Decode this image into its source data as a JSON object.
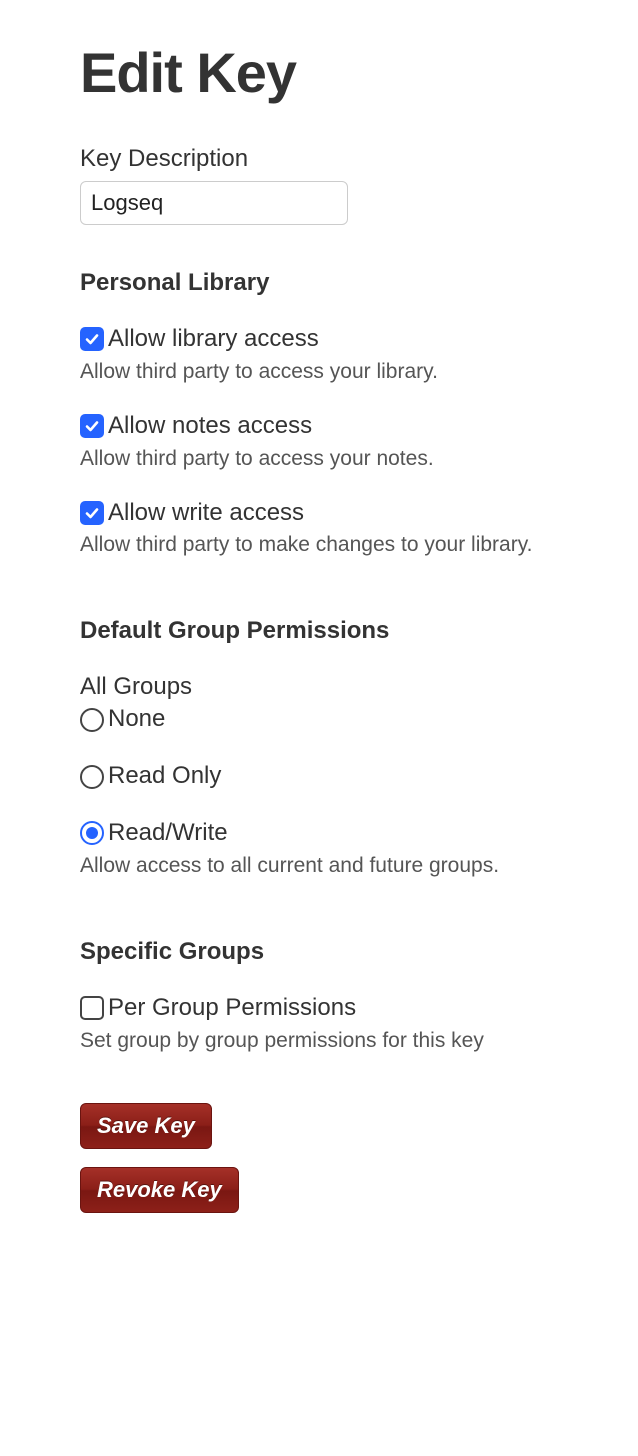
{
  "title": "Edit Key",
  "key_description": {
    "label": "Key Description",
    "value": "Logseq"
  },
  "personal_library": {
    "heading": "Personal Library",
    "options": [
      {
        "label": "Allow library access",
        "desc": "Allow third party to access your library.",
        "checked": true
      },
      {
        "label": "Allow notes access",
        "desc": "Allow third party to access your notes.",
        "checked": true
      },
      {
        "label": "Allow write access",
        "desc": "Allow third party to make changes to your library.",
        "checked": true
      }
    ]
  },
  "group_permissions": {
    "heading": "Default Group Permissions",
    "sub_heading": "All Groups",
    "radios": [
      {
        "label": "None",
        "desc": "",
        "selected": false
      },
      {
        "label": "Read Only",
        "desc": "",
        "selected": false
      },
      {
        "label": "Read/Write",
        "desc": "Allow access to all current and future groups.",
        "selected": true
      }
    ]
  },
  "specific_groups": {
    "heading": "Specific Groups",
    "option": {
      "label": "Per Group Permissions",
      "desc": "Set group by group permissions for this key",
      "checked": false
    }
  },
  "buttons": {
    "save": "Save Key",
    "revoke": "Revoke Key"
  }
}
